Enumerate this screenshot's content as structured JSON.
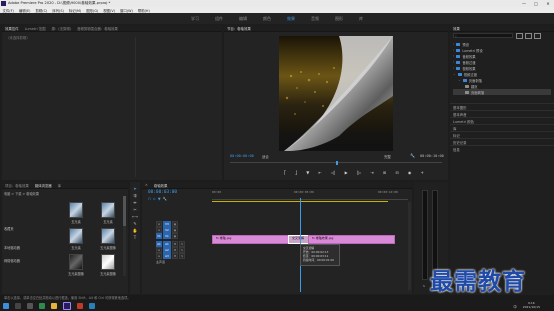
{
  "app": {
    "title": "Adobe Premiere Pro 2020 - D:\\视频\\9000\\卷轴效果.prproj *",
    "window_controls": [
      "—",
      "□",
      "✕"
    ]
  },
  "menu": [
    "文件(F)",
    "编辑(E)",
    "剪辑(C)",
    "序列(S)",
    "标记(M)",
    "图形(G)",
    "视图(V)",
    "窗口(W)",
    "帮助(H)"
  ],
  "workspaces": {
    "items": [
      "学习",
      "组件",
      "编辑",
      "颜色",
      "效果",
      "音频",
      "图形",
      "库"
    ],
    "active_index": 4
  },
  "source_panel": {
    "tabs": [
      "效果控件",
      "Lumetri 范围",
      "源：(无剪辑)",
      "音频剪辑混合器：卷轴效果"
    ],
    "active_index": 0,
    "no_clip_text": "（未选择剪辑）"
  },
  "program_monitor": {
    "tab": "节目：卷轴效果",
    "timecode_current": "00:00:00:00",
    "fit_label": "适合",
    "quality_label": "完整",
    "timecode_duration": "00:00:10:00",
    "transport_icons": [
      "标记入点",
      "标记出点",
      "添加标记",
      "转到入点",
      "后退一帧",
      "播放",
      "前进一帧",
      "转到出点",
      "插入",
      "覆盖",
      "导出帧",
      "按钮编辑器"
    ]
  },
  "project_panel": {
    "tabs": [
      "项目：卷轴效果",
      "媒体浏览器",
      "库"
    ],
    "active_index": 1,
    "breadcrumb": "电脑 > 下载 > 卷轴效果",
    "tree_items": [
      "本地驱动器",
      "网络驱动器"
    ],
    "side_items": [
      "收藏夹",
      "本地驱动器",
      "网络驱动器"
    ],
    "items": [
      {
        "label": "五元素"
      },
      {
        "label": "五元素"
      },
      {
        "label": "五元素"
      },
      {
        "label": "五元素图像"
      },
      {
        "label": "五元素图像"
      },
      {
        "label": "五元素图像"
      }
    ]
  },
  "timeline": {
    "tab": "卷轴效果",
    "timecode": "00:00:03:00",
    "ruler_ticks": [
      "00:00",
      "00:00:05:00",
      "00:00:10:00"
    ],
    "tracks": [
      {
        "name": "V3"
      },
      {
        "name": "V2"
      },
      {
        "name": "V1"
      },
      {
        "name": "A1"
      },
      {
        "name": "A2"
      },
      {
        "name": "A3"
      },
      {
        "name": "主声道"
      }
    ],
    "clips": [
      {
        "label": "fx 卷轴.jpg",
        "track": "V1"
      },
      {
        "label": "交叉溶解",
        "track": "V1"
      },
      {
        "label": "fx 卷轴效果.jpg",
        "track": "V1"
      }
    ],
    "tooltip": {
      "title": "交叉溶解",
      "lines": [
        "开始：00:00:02:13",
        "结束：00:00:03:11",
        "持续时间：00:00:01:00"
      ]
    }
  },
  "effects_panel": {
    "tab": "效果",
    "search_value": "",
    "tree": [
      {
        "label": "预设",
        "indent": 0
      },
      {
        "label": "Lumetri 预设",
        "indent": 0
      },
      {
        "label": "音频效果",
        "indent": 0
      },
      {
        "label": "音频过渡",
        "indent": 0
      },
      {
        "label": "视频效果",
        "indent": 0
      },
      {
        "label": "视频过渡",
        "indent": 0
      },
      {
        "label": "页面剥落",
        "indent": 1
      },
      {
        "label": "翻页",
        "indent": 2
      },
      {
        "label": "页面剥落",
        "indent": 2
      }
    ],
    "sections": [
      "基本图形",
      "基本声音",
      "Lumetri 颜色",
      "库",
      "标记",
      "历史记录",
      "信息"
    ]
  },
  "status_bar": {
    "text": "单击以选择，或单击空白处并拖动以进行框选。使用 Shift、Alt 和 Ctrl 可获得其他选项。"
  },
  "watermark": {
    "text": "最需教育"
  },
  "taskbar": {
    "time": "9:16",
    "date": "2021/10/15",
    "lang": "中"
  },
  "colors": {
    "accent_blue": "#3d9be9",
    "clip_pink": "#d98ad6",
    "playhead": "#3d9be9"
  }
}
